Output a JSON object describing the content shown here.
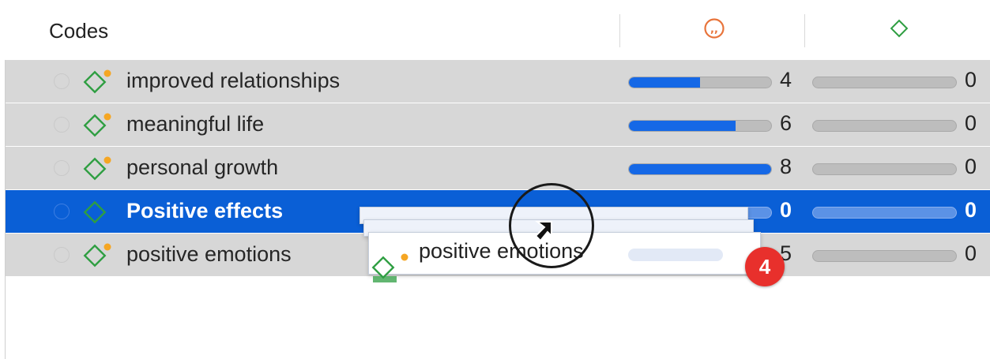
{
  "header": {
    "title": "Codes",
    "quotation_column_icon": "quotation-icon",
    "code_column_icon": "code-diamond-icon"
  },
  "colors": {
    "selection": "#0a5fd6",
    "bar_fill": "#1568e6",
    "code_icon": "#2e9e41",
    "comment_dot": "#f5a623",
    "quotation_icon": "#e8743b",
    "badge": "#e8302c"
  },
  "rows": [
    {
      "label": "improved relationships",
      "quotations": "4",
      "quotations_fill": 0.5,
      "codes": "0",
      "codes_fill": 0,
      "selected": false
    },
    {
      "label": "meaningful life",
      "quotations": "6",
      "quotations_fill": 0.75,
      "codes": "0",
      "codes_fill": 0,
      "selected": false
    },
    {
      "label": "personal growth",
      "quotations": "8",
      "quotations_fill": 1.0,
      "codes": "0",
      "codes_fill": 0,
      "selected": false
    },
    {
      "label": "Positive effects",
      "quotations": "0",
      "quotations_fill": 0,
      "codes": "0",
      "codes_fill": 0,
      "selected": true
    },
    {
      "label": "positive emotions",
      "quotations": "5",
      "quotations_fill": 0.6,
      "codes": "0",
      "codes_fill": 0,
      "selected": false
    }
  ],
  "drag_preview": {
    "label": "positive emotions",
    "count_badge": "4",
    "icon": "code-diamond-stack-icon"
  },
  "cursor": "drag-cursor-icon"
}
